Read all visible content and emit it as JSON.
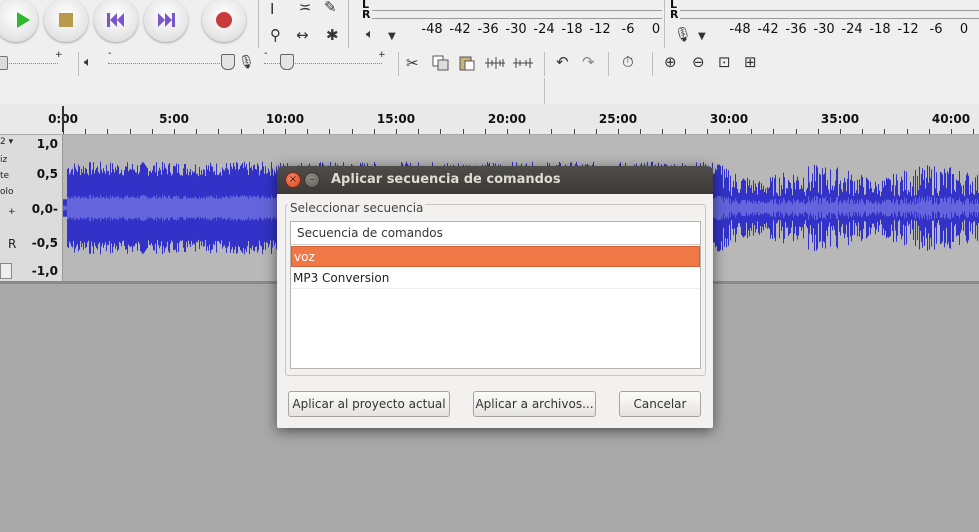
{
  "transport": {
    "play": "play-icon",
    "stop": "stop-icon",
    "skip_start": "skip-to-start-icon",
    "skip_end": "skip-to-end-icon",
    "record": "record-icon"
  },
  "meters": {
    "playback": {
      "left_label": "L",
      "right_label": "R",
      "scale": [
        "-48",
        "-42",
        "-36",
        "-30",
        "-24",
        "-18",
        "-12",
        "-6",
        "0"
      ]
    },
    "record": {
      "left_label": "L",
      "right_label": "R",
      "scale": [
        "-48",
        "-42",
        "-36",
        "-30",
        "-24",
        "-18",
        "-12",
        "-6",
        "0"
      ]
    }
  },
  "ruler": {
    "ticks": [
      "0:00",
      "5:00",
      "10:00",
      "15:00",
      "20:00",
      "25:00",
      "30:00",
      "35:00",
      "40:00"
    ]
  },
  "track": {
    "controls": [
      "iz",
      "te",
      "olo",
      "+",
      "R"
    ],
    "scale": [
      "1,0",
      "0,5",
      "0,0-",
      "-0,5",
      "-1,0"
    ]
  },
  "colors": {
    "waveform": "#3232c8",
    "waveform_rms": "#6464dc",
    "selection": "#f07746",
    "titlebar": "#3c3b37"
  },
  "dialog": {
    "title": "Aplicar secuencia de comandos",
    "group_label": "Seleccionar secuencia",
    "list_header": "Secuencia de comandos",
    "items": [
      {
        "label": "voz",
        "selected": true
      },
      {
        "label": "MP3 Conversion",
        "selected": false
      }
    ],
    "buttons": {
      "apply_project": "Aplicar al proyecto actual",
      "apply_files": "Aplicar a archivos...",
      "cancel": "Cancelar"
    }
  }
}
